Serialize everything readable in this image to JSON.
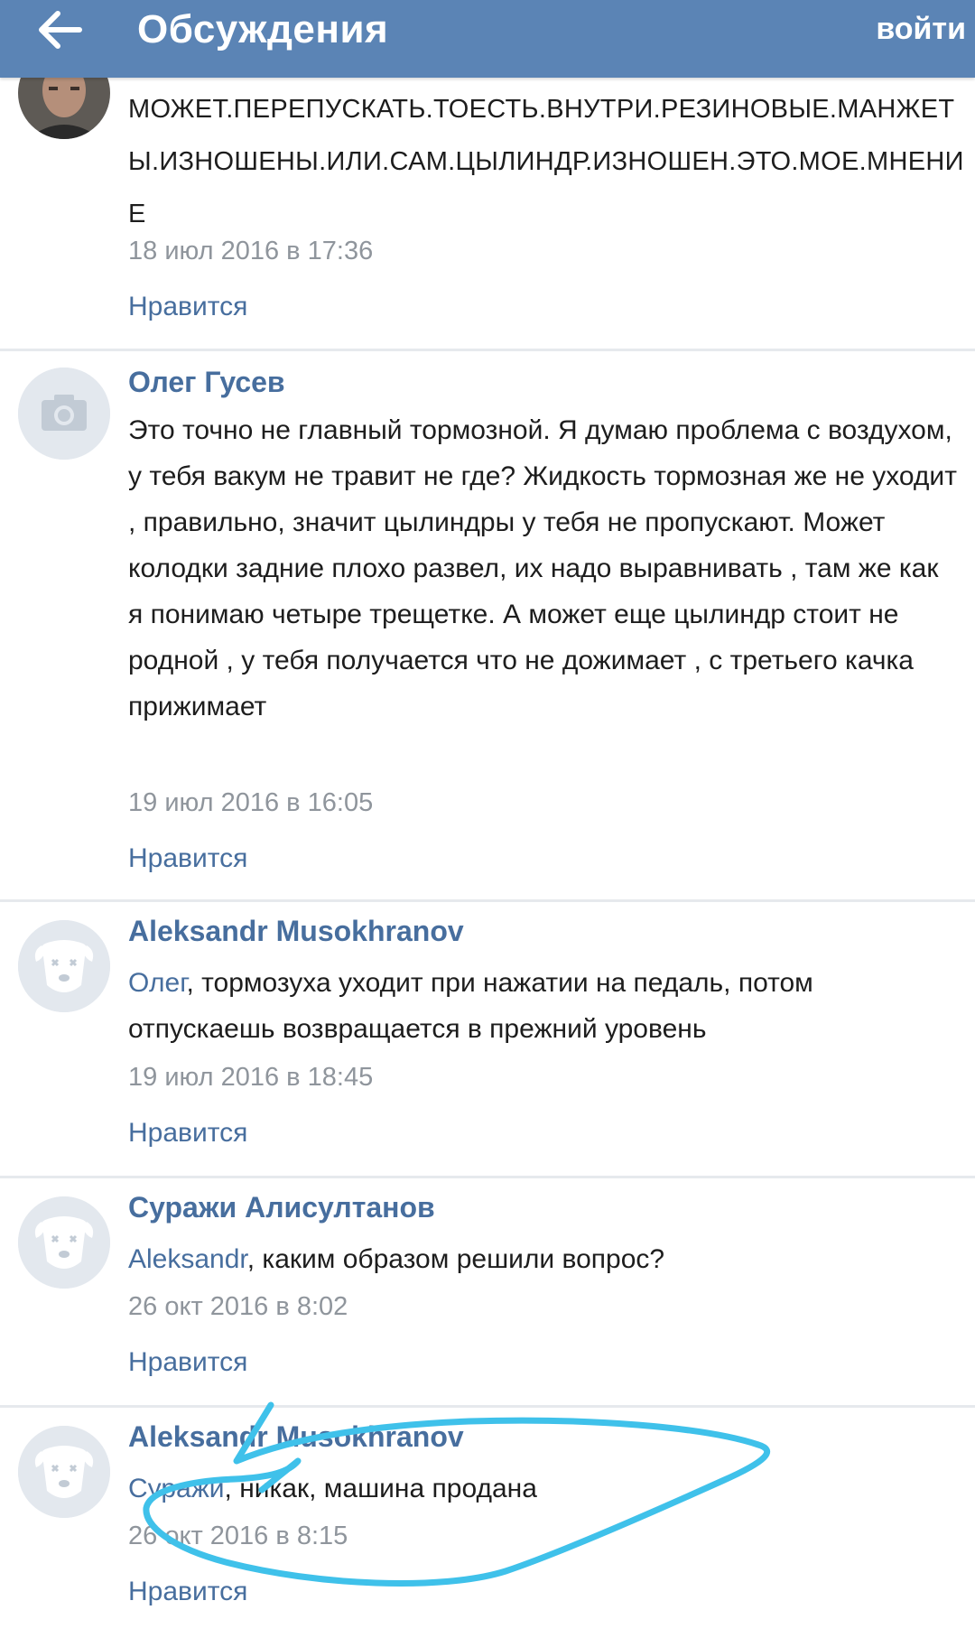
{
  "header": {
    "title": "Обсуждения",
    "login_label": "войти",
    "back_icon": "back-arrow-icon"
  },
  "colors": {
    "header_bg": "#5b84b5",
    "link": "#476e9e",
    "date": "#8f959c",
    "scribble": "#3fc1ea"
  },
  "comments": [
    {
      "author": "",
      "text": "МОЖЕТ.ПЕРЕПУСКАТЬ.ТОЕСТЬ.ВНУТРИ.РЕЗИНОВЫЕ.МАНЖЕТЫ.ИЗНОШЕНЫ.ИЛИ.САМ.ЦЫЛИНДР.ИЗНОШЕН.ЭТО.МОЕ.МНЕНИЕ",
      "date": "18 июл 2016 в 17:36",
      "like": "Нравится",
      "avatar": "user-photo-avatar"
    },
    {
      "author": "Олег Гусев",
      "text": "Это точно не главный тормозной. Я думаю проблема с воздухом, у тебя вакум не травит не где? Жидкость тормозная же не уходит , правильно, значит цылиндры у тебя не пропускают. Может колодки задние плохо развел, их надо выравнивать , там же как я понимаю четыре трещетке. А может еще цылиндр стоит не родной , у тебя получается что не дожимает , с третьего качка прижимает",
      "date": "19 июл 2016 в 16:05",
      "like": "Нравится",
      "avatar": "camera-placeholder-avatar"
    },
    {
      "author": "Aleksandr Musokhranov",
      "mention": "Олег",
      "text": ", тормозуха уходит при нажатии на педаль, потом отпускаешь возвращается в прежний уровень",
      "date": "19 июл 2016 в 18:45",
      "like": "Нравится",
      "avatar": "deactivated-dog-avatar"
    },
    {
      "author": "Суражи Алисултанов",
      "mention": "Aleksandr",
      "text": ", каким образом решили вопрос?",
      "date": "26 окт 2016 в 8:02",
      "like": "Нравится",
      "avatar": "deactivated-dog-avatar"
    },
    {
      "author": "Aleksandr Musokhranov",
      "mention": "Суражи",
      "text": ", никак, машина продана",
      "date": "26 окт 2016 в 8:15",
      "like": "Нравится",
      "avatar": "deactivated-dog-avatar"
    }
  ]
}
